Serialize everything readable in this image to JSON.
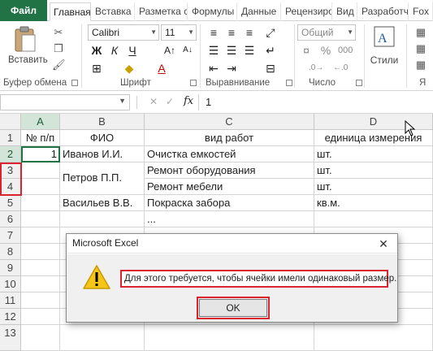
{
  "tabs": {
    "file": "Файл",
    "items": [
      "Главная",
      "Вставка",
      "Разметка с",
      "Формулы",
      "Данные",
      "Рецензиро",
      "Вид",
      "Разработч",
      "Fox"
    ]
  },
  "ribbon": {
    "paste_label": "Вставить",
    "groups": {
      "clipboard": "Буфер обмена",
      "font": "Шрифт",
      "alignment": "Выравнивание",
      "number": "Число",
      "styles": "Стили",
      "last": "Я"
    },
    "font_name": "Calibri",
    "font_size": "11",
    "number_format": "Общий",
    "bold": "Ж",
    "italic": "К",
    "underline": "Ч",
    "percent": "%",
    "font_color_glyph": "А"
  },
  "formula_bar": {
    "fx": "fx",
    "value": "1"
  },
  "sheet": {
    "columns": [
      "A",
      "B",
      "C",
      "D"
    ],
    "rows": [
      "1",
      "2",
      "3",
      "4",
      "5",
      "6",
      "7",
      "8",
      "9",
      "10",
      "11",
      "12",
      "13"
    ],
    "header_row": [
      "№ п/п",
      "ФИО",
      "вид работ",
      "единица измерения"
    ],
    "a2": "1",
    "b2": "Иванов И.И.",
    "b3": "Петров П.П.",
    "b5": "Васильев В.В.",
    "c2": "Очистка емкостей",
    "c3": "Ремонт оборудования",
    "c4": "Ремонт мебели",
    "c5": "Покраска забора",
    "c6": "...",
    "d2": "шт.",
    "d3": "шт.",
    "d4": "шт.",
    "d5": "кв.м."
  },
  "dialog": {
    "title": "Microsoft Excel",
    "message": "Для этого требуется, чтобы ячейки имели одинаковый размер.",
    "ok": "OK",
    "close_glyph": "✕"
  },
  "colors": {
    "accent": "#217346",
    "highlight": "#d9232f"
  }
}
